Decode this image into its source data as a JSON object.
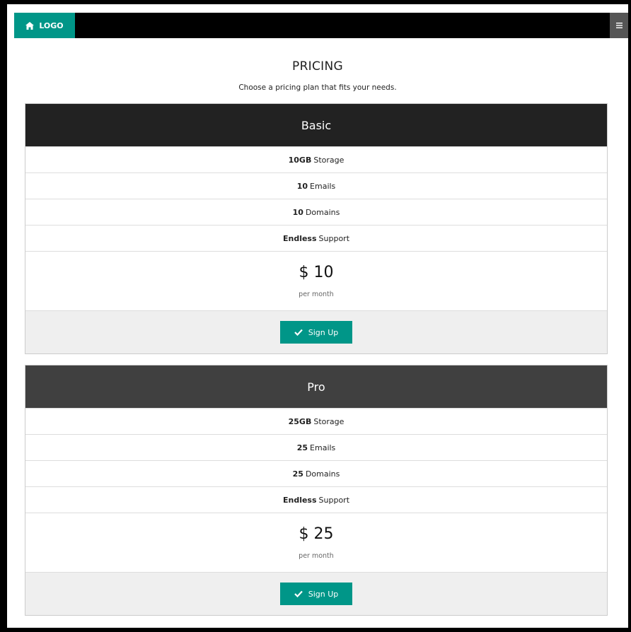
{
  "navbar": {
    "logo_icon": "home-icon",
    "logo_label": "LOGO",
    "menu_icon": "hamburger-menu-icon"
  },
  "header": {
    "title": "PRICING",
    "subtitle": "Choose a pricing plan that fits your needs."
  },
  "colors": {
    "brand": "#009688",
    "basic_head": "#222222",
    "pro_head": "#404040"
  },
  "plans": [
    {
      "name": "Basic",
      "features": [
        {
          "bold": "10GB",
          "text": "Storage"
        },
        {
          "bold": "10",
          "text": "Emails"
        },
        {
          "bold": "10",
          "text": "Domains"
        },
        {
          "bold": "Endless",
          "text": "Support"
        }
      ],
      "price": "$ 10",
      "period": "per month",
      "button_label": "Sign Up",
      "button_icon": "checkmark-icon"
    },
    {
      "name": "Pro",
      "features": [
        {
          "bold": "25GB",
          "text": "Storage"
        },
        {
          "bold": "25",
          "text": "Emails"
        },
        {
          "bold": "25",
          "text": "Domains"
        },
        {
          "bold": "Endless",
          "text": "Support"
        }
      ],
      "price": "$ 25",
      "period": "per month",
      "button_label": "Sign Up",
      "button_icon": "checkmark-icon"
    }
  ]
}
